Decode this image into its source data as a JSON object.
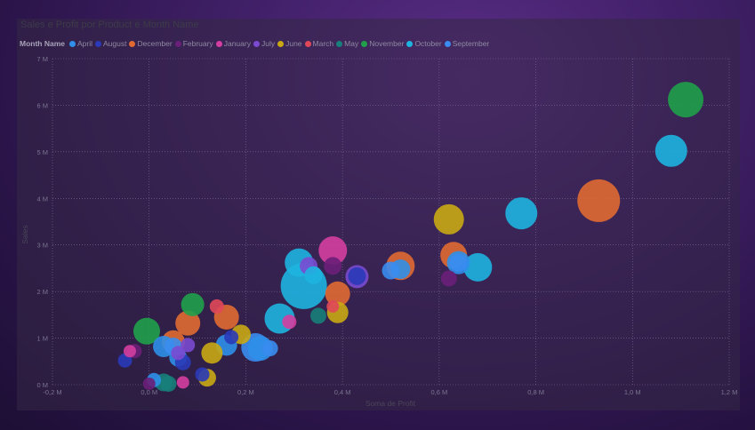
{
  "chart_data": {
    "type": "scatter",
    "title": "Sales e Profit por Product e Month Name",
    "xlabel": "Soma de Profit",
    "ylabel": "Sales",
    "xlim": [
      -0.2,
      1.2
    ],
    "ylim": [
      0,
      7
    ],
    "x_ticks": [
      "-0,2 M",
      "0,0 M",
      "0,2 M",
      "0,4 M",
      "0,6 M",
      "0,8 M",
      "1,0 M",
      "1,2 M"
    ],
    "y_ticks": [
      "0 M",
      "1 M",
      "2 M",
      "3 M",
      "4 M",
      "5 M",
      "6 M",
      "7 M"
    ],
    "grid": true,
    "legend_title": "Month Name",
    "legend_position": "top-left",
    "series": [
      {
        "name": "April",
        "color": "#2f8fe8",
        "points": [
          [
            0.03,
            0.82,
            12
          ],
          [
            0.06,
            0.58,
            10
          ],
          [
            0.16,
            0.85,
            12
          ],
          [
            0.23,
            0.78,
            14
          ],
          [
            0.52,
            2.48,
            11
          ],
          [
            0.64,
            2.62,
            13
          ],
          [
            0.01,
            0.1,
            8
          ]
        ]
      },
      {
        "name": "August",
        "color": "#2a3ab8",
        "points": [
          [
            -0.05,
            0.52,
            8
          ],
          [
            0.07,
            0.48,
            9
          ],
          [
            0.11,
            0.22,
            8
          ],
          [
            0.17,
            1.02,
            8
          ],
          [
            0.43,
            2.33,
            10
          ]
        ]
      },
      {
        "name": "December",
        "color": "#e06a32",
        "points": [
          [
            0.08,
            1.32,
            14
          ],
          [
            0.05,
            0.92,
            13
          ],
          [
            0.16,
            1.45,
            14
          ],
          [
            0.39,
            1.95,
            14
          ],
          [
            0.52,
            2.55,
            16
          ],
          [
            0.63,
            2.78,
            15
          ],
          [
            0.93,
            3.95,
            24
          ]
        ]
      },
      {
        "name": "February",
        "color": "#6a1f78",
        "points": [
          [
            0.0,
            0.02,
            7
          ],
          [
            -0.03,
            0.72,
            8
          ],
          [
            0.38,
            2.55,
            10
          ],
          [
            0.62,
            2.28,
            9
          ]
        ]
      },
      {
        "name": "January",
        "color": "#d43ea0",
        "points": [
          [
            0.38,
            2.88,
            16
          ],
          [
            0.29,
            1.35,
            8
          ],
          [
            0.07,
            0.05,
            7
          ],
          [
            -0.04,
            0.72,
            7
          ]
        ]
      },
      {
        "name": "July",
        "color": "#7a4ad0",
        "points": [
          [
            0.06,
            0.68,
            8
          ],
          [
            0.33,
            2.55,
            10
          ],
          [
            0.43,
            2.32,
            13
          ],
          [
            0.08,
            0.85,
            8
          ]
        ]
      },
      {
        "name": "June",
        "color": "#c9a814",
        "points": [
          [
            0.62,
            3.55,
            17
          ],
          [
            0.13,
            0.68,
            12
          ],
          [
            0.19,
            1.08,
            11
          ],
          [
            0.39,
            1.55,
            12
          ],
          [
            0.12,
            0.15,
            10
          ]
        ]
      },
      {
        "name": "March",
        "color": "#e04858",
        "points": [
          [
            0.14,
            1.68,
            8
          ],
          [
            0.38,
            1.68,
            7
          ]
        ]
      },
      {
        "name": "May",
        "color": "#17807a",
        "points": [
          [
            0.35,
            1.48,
            9
          ],
          [
            0.03,
            0.05,
            10
          ],
          [
            0.04,
            0.02,
            9
          ]
        ]
      },
      {
        "name": "November",
        "color": "#20a04a",
        "points": [
          [
            -0.005,
            1.15,
            15
          ],
          [
            0.09,
            1.72,
            13
          ],
          [
            1.11,
            6.12,
            20
          ]
        ]
      },
      {
        "name": "October",
        "color": "#1eb4e0",
        "points": [
          [
            0.32,
            2.12,
            26
          ],
          [
            0.27,
            1.42,
            17
          ],
          [
            0.31,
            2.62,
            16
          ],
          [
            0.34,
            2.35,
            10
          ],
          [
            0.68,
            2.52,
            16
          ],
          [
            0.77,
            3.68,
            18
          ],
          [
            1.08,
            5.02,
            18
          ]
        ]
      },
      {
        "name": "September",
        "color": "#3a8cf0",
        "points": [
          [
            0.05,
            0.82,
            10
          ],
          [
            0.22,
            0.8,
            16
          ],
          [
            0.25,
            0.78,
            9
          ],
          [
            0.64,
            2.62,
            10
          ],
          [
            0.5,
            2.45,
            10
          ]
        ]
      }
    ]
  }
}
